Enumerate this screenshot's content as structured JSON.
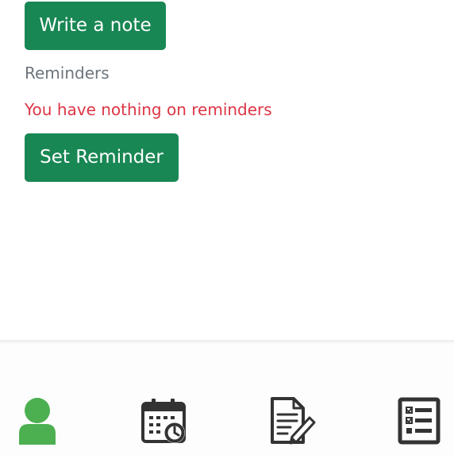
{
  "notes": {
    "write_note_label": "Write a note"
  },
  "reminders": {
    "section_label": "Reminders",
    "empty_message": "You have nothing on reminders",
    "set_reminder_label": "Set Reminder"
  },
  "bottom_nav": {
    "items": [
      {
        "icon": "user-icon",
        "active": true,
        "color": "#4caf50"
      },
      {
        "icon": "calendar-clock-icon",
        "active": false,
        "color": "#333333"
      },
      {
        "icon": "edit-document-icon",
        "active": false,
        "color": "#333333"
      },
      {
        "icon": "checklist-icon",
        "active": false,
        "color": "#333333"
      }
    ]
  },
  "colors": {
    "primary_button": "#198754",
    "muted_text": "#6c757d",
    "danger_text": "#dc3545",
    "active_nav": "#4caf50",
    "inactive_nav": "#333333"
  }
}
